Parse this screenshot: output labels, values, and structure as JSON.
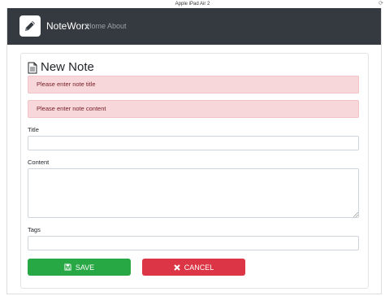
{
  "device": {
    "title": "Apple iPad Air 2",
    "rotate_icon": "rotate-icon"
  },
  "navbar": {
    "brand_icon": "pencil-icon",
    "brand": "NoteWorx",
    "links": [
      "Home",
      "About"
    ]
  },
  "form": {
    "heading_icon": "document-icon",
    "heading": "New Note",
    "alerts": [
      "Please enter note title",
      "Please enter note content"
    ],
    "fields": {
      "title": {
        "label": "Title",
        "value": "",
        "placeholder": ""
      },
      "content": {
        "label": "Content",
        "value": "",
        "placeholder": ""
      },
      "tags": {
        "label": "Tags",
        "value": "",
        "placeholder": ""
      }
    },
    "buttons": {
      "save": {
        "label": "SAVE",
        "icon": "floppy-disk-icon"
      },
      "cancel": {
        "label": "CANCEL",
        "icon": "close-icon"
      }
    }
  },
  "colors": {
    "navbar_bg": "#343a40",
    "alert_bg": "#f8d7da",
    "alert_text": "#721c24",
    "save_bg": "#28a745",
    "cancel_bg": "#dc3545"
  }
}
